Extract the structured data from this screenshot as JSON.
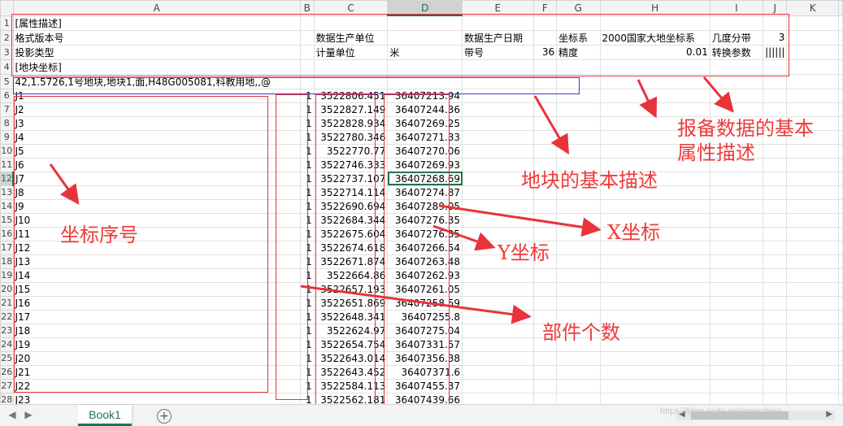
{
  "columns": [
    "A",
    "B",
    "C",
    "D",
    "E",
    "F",
    "G",
    "H",
    "I",
    "J",
    "K"
  ],
  "selected_column": "D",
  "selected_row": "12",
  "rows": [
    {
      "n": "1",
      "A": "[属性描述]"
    },
    {
      "n": "2",
      "A": "格式版本号",
      "C": "数据生产单位",
      "E": "数据生产日期",
      "G": "坐标系",
      "H": "2000国家大地坐标系",
      "I": "几度分带",
      "J": "3"
    },
    {
      "n": "3",
      "A": "投影类型",
      "C": "计量单位",
      "D": "米",
      "E": "带号",
      "F": "36",
      "G": "精度",
      "H": "0.01",
      "I": "转换参数",
      "J": "||||||"
    },
    {
      "n": "4",
      "A": "[地块坐标]"
    },
    {
      "n": "5",
      "A": "42,1.5726,1号地块,地块1,面,H48G005081,科教用地,,@"
    },
    {
      "n": "6",
      "A": "J1",
      "B": "1",
      "C": "3522806.451",
      "D": "36407213.94"
    },
    {
      "n": "7",
      "A": "J2",
      "B": "1",
      "C": "3522827.149",
      "D": "36407244.36"
    },
    {
      "n": "8",
      "A": "J3",
      "B": "1",
      "C": "3522828.934",
      "D": "36407269.25"
    },
    {
      "n": "9",
      "A": "J4",
      "B": "1",
      "C": "3522780.346",
      "D": "36407271.33"
    },
    {
      "n": "10",
      "A": "J5",
      "B": "1",
      "C": "3522770.77",
      "D": "36407270.06"
    },
    {
      "n": "11",
      "A": "J6",
      "B": "1",
      "C": "3522746.333",
      "D": "36407269.93"
    },
    {
      "n": "12",
      "A": "J7",
      "B": "1",
      "C": "3522737.107",
      "D": "36407268.69"
    },
    {
      "n": "13",
      "A": "J8",
      "B": "1",
      "C": "3522714.114",
      "D": "36407274.87"
    },
    {
      "n": "14",
      "A": "J9",
      "B": "1",
      "C": "3522690.694",
      "D": "36407289.05"
    },
    {
      "n": "15",
      "A": "J10",
      "B": "1",
      "C": "3522684.344",
      "D": "36407276.35"
    },
    {
      "n": "16",
      "A": "J11",
      "B": "1",
      "C": "3522675.604",
      "D": "36407276.35"
    },
    {
      "n": "17",
      "A": "J12",
      "B": "1",
      "C": "3522674.618",
      "D": "36407266.54"
    },
    {
      "n": "18",
      "A": "J13",
      "B": "1",
      "C": "3522671.874",
      "D": "36407263.48"
    },
    {
      "n": "19",
      "A": "J14",
      "B": "1",
      "C": "3522664.86",
      "D": "36407262.93"
    },
    {
      "n": "20",
      "A": "J15",
      "B": "1",
      "C": "3522657.193",
      "D": "36407261.05"
    },
    {
      "n": "21",
      "A": "J16",
      "B": "1",
      "C": "3522651.869",
      "D": "36407258.59"
    },
    {
      "n": "22",
      "A": "J17",
      "B": "1",
      "C": "3522648.341",
      "D": "36407255.8"
    },
    {
      "n": "23",
      "A": "J18",
      "B": "1",
      "C": "3522624.97",
      "D": "36407275.04"
    },
    {
      "n": "24",
      "A": "J19",
      "B": "1",
      "C": "3522654.754",
      "D": "36407331.57"
    },
    {
      "n": "25",
      "A": "J20",
      "B": "1",
      "C": "3522643.014",
      "D": "36407356.38"
    },
    {
      "n": "26",
      "A": "J21",
      "B": "1",
      "C": "3522643.452",
      "D": "36407371.6"
    },
    {
      "n": "27",
      "A": "J22",
      "B": "1",
      "C": "3522584.113",
      "D": "36407455.37"
    },
    {
      "n": "28",
      "A": "J23",
      "B": "1",
      "C": "3522562.181",
      "D": "36407439.66"
    }
  ],
  "annotations": {
    "attr_desc": "报备数据的基本\n属性描述",
    "parcel_desc": "地块的基本描述",
    "x_coord": "X坐标",
    "y_coord": "Y坐标",
    "point_no": "坐标序号",
    "part_count": "部件个数"
  },
  "sheet_tab": "Book1",
  "add_sheet_icon": "plus-circle-icon",
  "nav_icons": [
    "chevron-left-icon",
    "chevron-right-icon"
  ],
  "watermark": "https://blog.csdn.net/meechina",
  "colors": {
    "annotation_red": "#e8333a",
    "parcel_box_blue": "#2f3fc8",
    "excel_green": "#217346"
  }
}
